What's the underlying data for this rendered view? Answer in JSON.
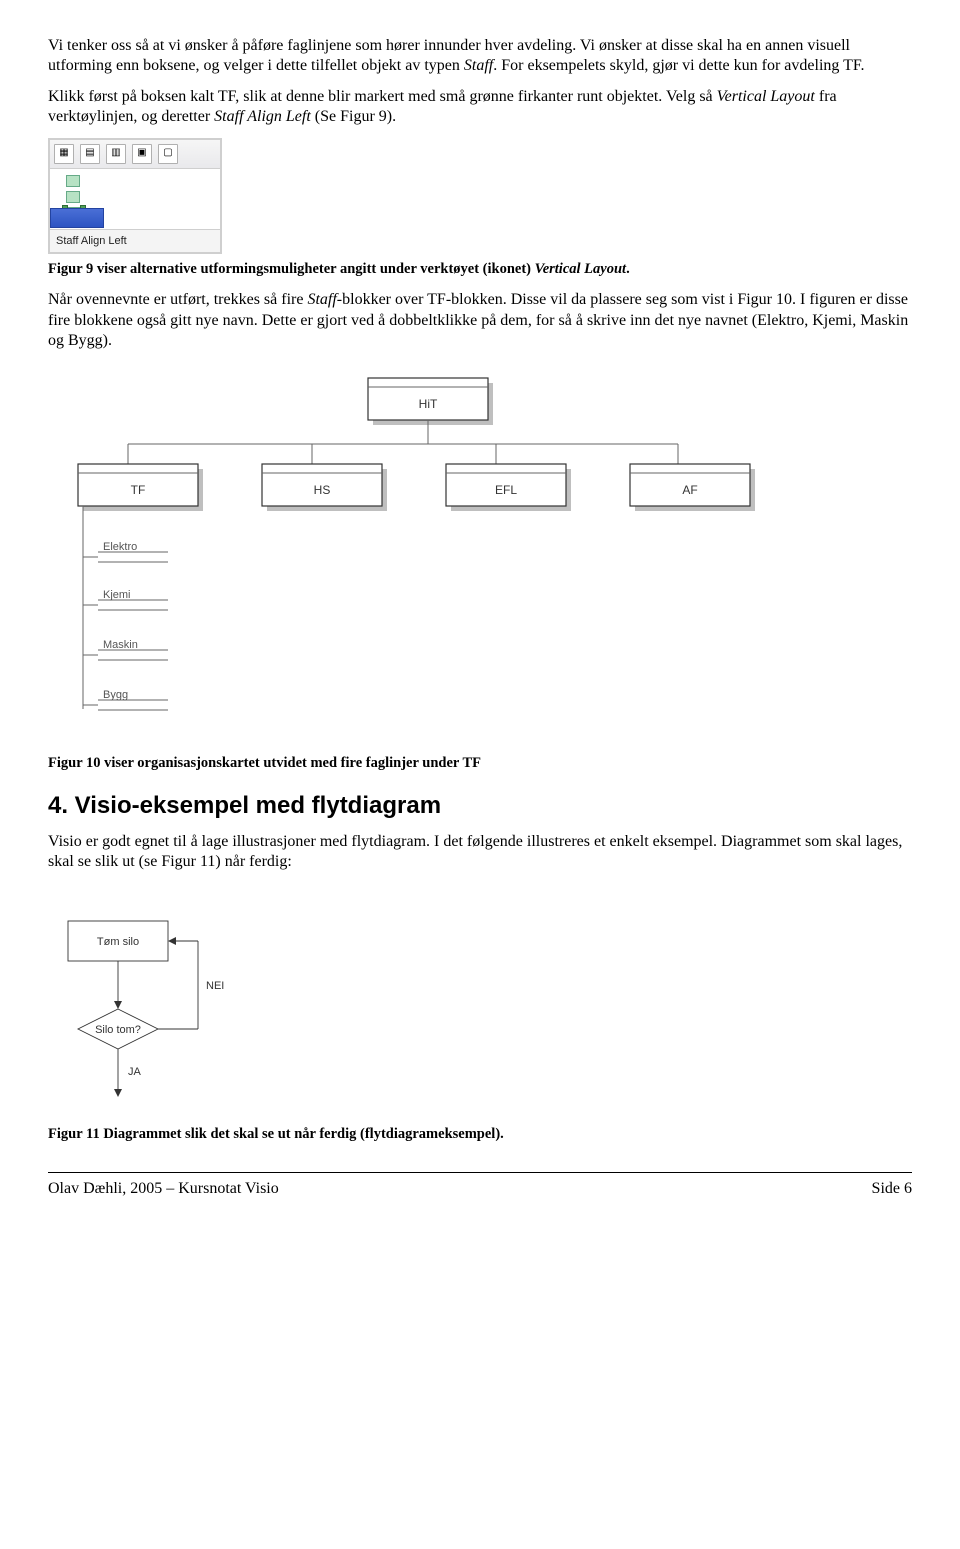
{
  "para1_a": "Vi tenker oss så at vi ønsker å påføre faglinjene som hører innunder hver avdeling. Vi ønsker at disse skal ha en annen visuell utforming enn boksene, og velger i dette tilfellet objekt av typen ",
  "para1_i1": "Staff",
  "para1_b": ". For eksempelets skyld, gjør vi dette kun for avdeling TF.",
  "para2_a": "Klikk først på boksen kalt TF, slik at denne blir markert med små grønne firkanter runt objektet. Velg så ",
  "para2_i1": "Vertical Layout",
  "para2_b": " fra verktøylinjen, og deretter ",
  "para2_i2": "Staff Align Left",
  "para2_c": " (Se Figur 9).",
  "fig9_status": "Staff Align Left",
  "fig9_caption_a": "Figur 9 viser alternative utformingsmuligheter angitt under verktøyet (ikonet) ",
  "fig9_caption_i": "Vertical Layout",
  "fig9_caption_b": ".",
  "para3_a": "Når ovennevnte er utført, trekkes så fire ",
  "para3_i1": "Staff",
  "para3_b": "-blokker over TF-blokken. Disse vil da plassere seg som vist i Figur 10. I figuren er disse fire blokkene også gitt nye navn. Dette er gjort ved å dobbeltklikke på dem, for så å skrive inn det nye navnet (Elektro, Kjemi, Maskin og Bygg).",
  "org": {
    "top": "HiT",
    "row": [
      "TF",
      "HS",
      "EFL",
      "AF"
    ],
    "staff": [
      "Elektro",
      "Kjemi",
      "Maskin",
      "Bygg"
    ]
  },
  "fig10_caption": "Figur 10 viser organisasjonskartet utvidet med fire faglinjer under TF",
  "section4": "4. Visio-eksempel med flytdiagram",
  "para4": "Visio er godt egnet til å lage illustrasjoner med flytdiagram. I det følgende illustreres et enkelt eksempel. Diagrammet som skal lages, skal se slik ut (se Figur 11) når ferdig:",
  "flow": {
    "box": "Tøm silo",
    "dec": "Silo tom?",
    "nei": "NEI",
    "ja": "JA"
  },
  "fig11_caption": "Figur 11 Diagrammet slik det skal se ut når ferdig (flytdiagrameksempel).",
  "footer_left": "Olav Dæhli, 2005 – Kursnotat Visio",
  "footer_right": "Side 6"
}
